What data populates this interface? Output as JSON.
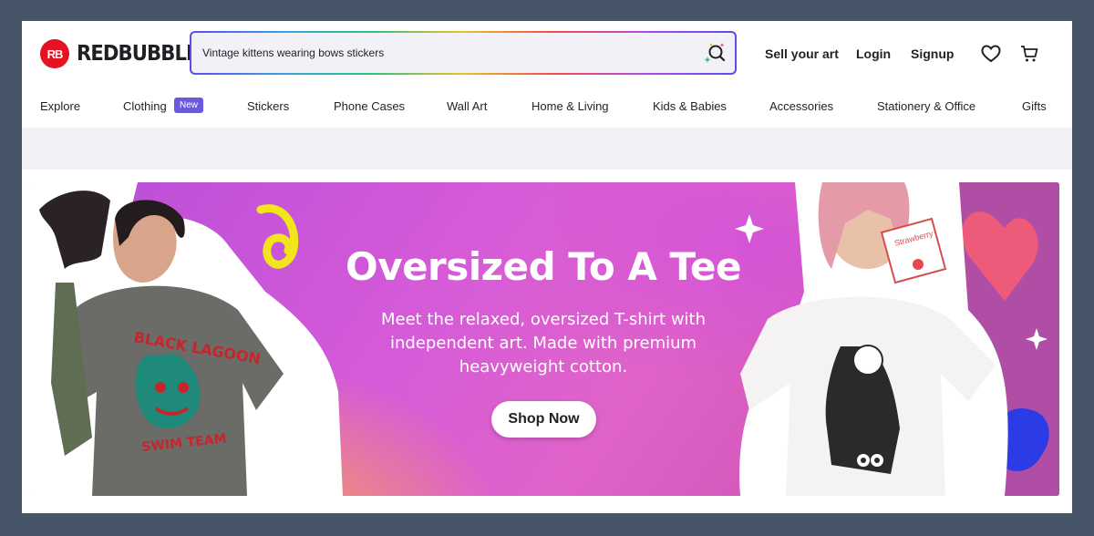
{
  "brand": {
    "logo_mark": "RB",
    "name": "REDBUBBLE"
  },
  "search": {
    "value": "Vintage kittens wearing bows stickers",
    "icon": "sparkle-search-icon"
  },
  "header_links": {
    "sell": "Sell your art",
    "login": "Login",
    "signup": "Signup"
  },
  "header_icons": [
    "heart-icon",
    "cart-icon"
  ],
  "nav": {
    "items": [
      {
        "label": "Explore"
      },
      {
        "label": "Clothing",
        "badge": "New"
      },
      {
        "label": "Stickers"
      },
      {
        "label": "Phone Cases"
      },
      {
        "label": "Wall Art"
      },
      {
        "label": "Home & Living"
      },
      {
        "label": "Kids & Babies"
      },
      {
        "label": "Accessories"
      },
      {
        "label": "Stationery & Office"
      },
      {
        "label": "Gifts"
      }
    ]
  },
  "hero": {
    "title": "Oversized To A Tee",
    "subtitle": "Meet the relaxed, oversized T-shirt with independent art. Made with premium heavyweight cotton.",
    "cta": "Shop Now",
    "left_shirt_text": "BLACK LAGOON",
    "left_shirt_text_bottom": "SWIM TEAM",
    "right_carton_text": "Strawberry"
  },
  "colors": {
    "brand_red": "#e41321",
    "badge": "#6a5ae0",
    "hero_pink": "#d65bd8",
    "hero_orange": "#ffaa46"
  }
}
